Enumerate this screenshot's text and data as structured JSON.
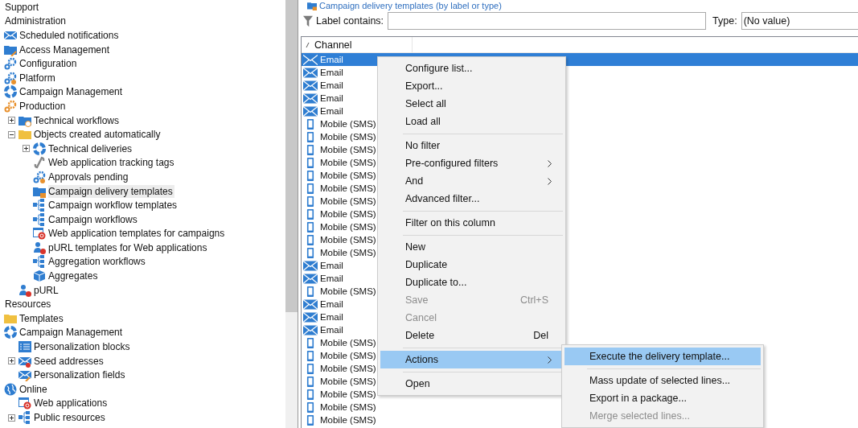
{
  "tree": [
    {
      "label": "Support",
      "selected": false
    },
    {
      "label": "Administration",
      "selected": false,
      "children": [
        {
          "label": "Scheduled notifications",
          "kind": "envelope",
          "selected": false
        },
        {
          "label": "Access Management",
          "kind": "folder-key",
          "selected": false
        },
        {
          "label": "Configuration",
          "kind": "gears",
          "selected": false
        },
        {
          "label": "Platform",
          "kind": "gear",
          "selected": false
        },
        {
          "label": "Campaign Management",
          "kind": "ring",
          "selected": false
        },
        {
          "label": "Production",
          "kind": "gears-orange",
          "selected": false,
          "children": [
            {
              "label": "Technical workflows",
              "kind": "folder-clock",
              "selected": false,
              "expanded": false
            },
            {
              "label": "Objects created automatically",
              "kind": "folder",
              "selected": false,
              "expanded": true,
              "children": [
                {
                  "label": "Technical deliveries",
                  "kind": "ring",
                  "selected": false,
                  "expanded": false
                },
                {
                  "label": "Web application tracking tags",
                  "kind": "link",
                  "selected": false
                },
                {
                  "label": "Approvals pending",
                  "kind": "gear-person",
                  "selected": false
                },
                {
                  "label": "Campaign delivery templates",
                  "kind": "folder-mail",
                  "selected": true
                },
                {
                  "label": "Campaign workflow templates",
                  "kind": "workflow",
                  "selected": false
                },
                {
                  "label": "Campaign workflows",
                  "kind": "workflow",
                  "selected": false
                },
                {
                  "label": "Web application templates for campaigns",
                  "kind": "web",
                  "selected": false
                },
                {
                  "label": "pURL templates for Web applications",
                  "kind": "person",
                  "selected": false
                },
                {
                  "label": "Aggregation workflows",
                  "kind": "workflow",
                  "selected": false
                },
                {
                  "label": "Aggregates",
                  "kind": "cube",
                  "selected": false
                }
              ]
            },
            {
              "label": "pURL",
              "kind": "person",
              "selected": false
            }
          ]
        }
      ]
    },
    {
      "label": "Resources",
      "selected": false,
      "children": [
        {
          "label": "Templates",
          "kind": "folder",
          "selected": false
        },
        {
          "label": "Campaign Management",
          "kind": "ring",
          "selected": false,
          "children": [
            {
              "label": "Personalization blocks",
              "kind": "list",
              "selected": false
            },
            {
              "label": "Seed addresses",
              "kind": "envelope-alert",
              "selected": false,
              "expanded": false
            },
            {
              "label": "Personalization fields",
              "kind": "envelope-key",
              "selected": false
            }
          ]
        },
        {
          "label": "Online",
          "kind": "globe",
          "selected": false,
          "children": [
            {
              "label": "Web applications",
              "kind": "web",
              "selected": false
            },
            {
              "label": "Public resources",
              "kind": "workflow",
              "selected": false,
              "expanded": false
            }
          ]
        }
      ]
    }
  ],
  "title": "Campaign delivery templates (by label or type)",
  "filter": {
    "label": "Label contains:",
    "type_label": "Type:",
    "type_value": "(No value)"
  },
  "columns": [
    "Channel"
  ],
  "rows": [
    {
      "channel": "Email",
      "kind": "email",
      "selected": true
    },
    {
      "channel": "Email",
      "kind": "email",
      "selected": false
    },
    {
      "channel": "Email",
      "kind": "email",
      "selected": false
    },
    {
      "channel": "Email",
      "kind": "email",
      "selected": false
    },
    {
      "channel": "Email",
      "kind": "email",
      "selected": false
    },
    {
      "channel": "Mobile (SMS)",
      "kind": "sms",
      "selected": false
    },
    {
      "channel": "Mobile (SMS)",
      "kind": "sms",
      "selected": false
    },
    {
      "channel": "Mobile (SMS)",
      "kind": "sms",
      "selected": false
    },
    {
      "channel": "Mobile (SMS)",
      "kind": "sms",
      "selected": false
    },
    {
      "channel": "Mobile (SMS)",
      "kind": "sms",
      "selected": false
    },
    {
      "channel": "Mobile (SMS)",
      "kind": "sms",
      "selected": false
    },
    {
      "channel": "Mobile (SMS)",
      "kind": "sms",
      "selected": false
    },
    {
      "channel": "Mobile (SMS)",
      "kind": "sms",
      "selected": false
    },
    {
      "channel": "Mobile (SMS)",
      "kind": "sms",
      "selected": false
    },
    {
      "channel": "Mobile (SMS)",
      "kind": "sms",
      "selected": false
    },
    {
      "channel": "Mobile (SMS)",
      "kind": "sms",
      "selected": false
    },
    {
      "channel": "Email",
      "kind": "email",
      "selected": false
    },
    {
      "channel": "Email",
      "kind": "email",
      "selected": false
    },
    {
      "channel": "Mobile (SMS)",
      "kind": "sms",
      "selected": false
    },
    {
      "channel": "Email",
      "kind": "email",
      "selected": false
    },
    {
      "channel": "Email",
      "kind": "email",
      "selected": false
    },
    {
      "channel": "Email",
      "kind": "email",
      "selected": false
    },
    {
      "channel": "Mobile (SMS)",
      "kind": "sms",
      "selected": false
    },
    {
      "channel": "Mobile (SMS)",
      "kind": "sms",
      "selected": false
    },
    {
      "channel": "Mobile (SMS)",
      "kind": "sms",
      "selected": false
    },
    {
      "channel": "Mobile (SMS)",
      "kind": "sms",
      "selected": false
    },
    {
      "channel": "Mobile (SMS)",
      "kind": "sms",
      "selected": false
    },
    {
      "channel": "Mobile (SMS)",
      "kind": "sms",
      "selected": false
    },
    {
      "channel": "Mobile (SMS)",
      "kind": "sms",
      "selected": false
    }
  ],
  "menu": [
    {
      "kind": "item",
      "label": "Configure list...",
      "disabled": false,
      "selected": false
    },
    {
      "kind": "item",
      "label": "Export...",
      "disabled": false,
      "selected": false
    },
    {
      "kind": "item",
      "label": "Select all",
      "disabled": false,
      "selected": false
    },
    {
      "kind": "item",
      "label": "Load all",
      "disabled": false,
      "selected": false
    },
    {
      "kind": "separator"
    },
    {
      "kind": "item",
      "label": "No filter",
      "disabled": false,
      "selected": false
    },
    {
      "kind": "submenu",
      "label": "Pre-configured filters",
      "disabled": false,
      "selected": false
    },
    {
      "kind": "submenu",
      "label": "And",
      "disabled": false,
      "selected": false
    },
    {
      "kind": "item",
      "label": "Advanced filter...",
      "disabled": false,
      "selected": false
    },
    {
      "kind": "separator"
    },
    {
      "kind": "item",
      "label": "Filter on this column",
      "disabled": false,
      "selected": false
    },
    {
      "kind": "separator"
    },
    {
      "kind": "item",
      "label": "New",
      "disabled": false,
      "selected": false
    },
    {
      "kind": "item",
      "label": "Duplicate",
      "disabled": false,
      "selected": false
    },
    {
      "kind": "item",
      "label": "Duplicate to...",
      "disabled": false,
      "selected": false
    },
    {
      "kind": "item",
      "label": "Save",
      "shortcut": "Ctrl+S",
      "disabled": true,
      "selected": false
    },
    {
      "kind": "item",
      "label": "Cancel",
      "disabled": true,
      "selected": false
    },
    {
      "kind": "item",
      "label": "Delete",
      "shortcut": "Del",
      "disabled": false,
      "selected": false
    },
    {
      "kind": "separator"
    },
    {
      "kind": "submenu",
      "label": "Actions",
      "disabled": false,
      "selected": true
    },
    {
      "kind": "separator"
    },
    {
      "kind": "item",
      "label": "Open",
      "disabled": false,
      "selected": false
    }
  ],
  "submenu": [
    {
      "kind": "item",
      "label": "Execute the delivery template...",
      "disabled": false,
      "selected": true
    },
    {
      "kind": "separator"
    },
    {
      "kind": "item",
      "label": "Mass update of selected lines...",
      "disabled": false,
      "selected": false
    },
    {
      "kind": "item",
      "label": "Export in a package...",
      "disabled": false,
      "selected": false
    },
    {
      "kind": "item",
      "label": "Merge selected lines...",
      "disabled": true,
      "selected": false
    }
  ]
}
